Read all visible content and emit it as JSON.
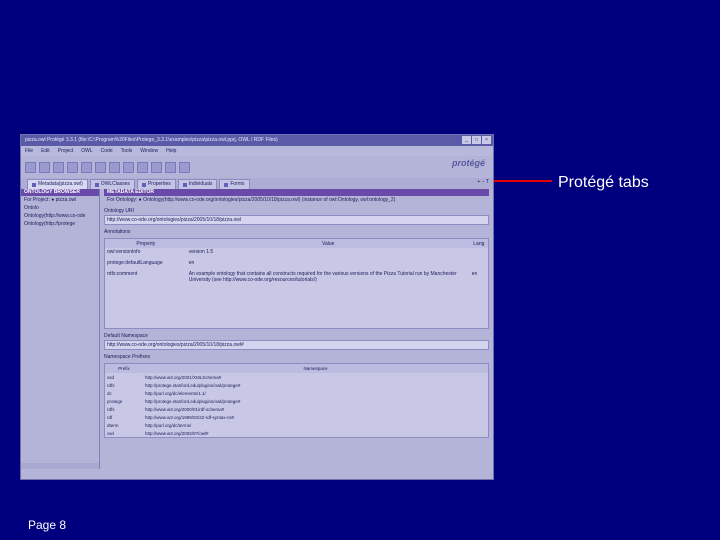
{
  "callout": "Protégé tabs",
  "page_label": "Page 8",
  "window": {
    "title": "pizza.owl  Protégé 3.3.1   (file:\\C:\\Program%20Files\\Protege_3.3.1\\examples\\pizza\\pizza.owl.pprj, OWL / RDF Files)",
    "controls": [
      "_",
      "□",
      "×"
    ]
  },
  "menu": [
    "File",
    "Edit",
    "Project",
    "OWL",
    "Code",
    "Tools",
    "Window",
    "Help"
  ],
  "logo": "protégé",
  "tabs": [
    {
      "label": "Metadata(pizza.owl)",
      "active": true
    },
    {
      "label": "OWLClasses",
      "active": false
    },
    {
      "label": "Properties",
      "active": false
    },
    {
      "label": "Individuals",
      "active": false
    },
    {
      "label": "Forms",
      "active": false
    }
  ],
  "tab_controls": "+  −  T",
  "left": {
    "header": "ONTOLOGY BROWSER",
    "project": "For Project:  ● pizza.owl",
    "ontologies": "Ontolo",
    "item1": "Ontology(http://www.co-ode",
    "item2": "Ontology(http://protege"
  },
  "right": {
    "header": "METADATA EDITOR",
    "for_ontology": "For Ontology:  ● Ontology(http://www.co-ode.org/ontologies/pizza/2005/10/18/pizza.owl)    (instance of owl:Ontology, owl:ontology_2)",
    "uri_label": "Ontology URI",
    "uri_value": "http://www.co-ode.org/ontologies/pizza/2005/10/18/pizza.owl",
    "annotations_label": "Annotations",
    "annot_headers": [
      "Property",
      "Value",
      "Lang"
    ],
    "annotations": [
      {
        "prop": "owl:versionInfo",
        "value": "version 1.5",
        "lang": ""
      },
      {
        "prop": "protege:defaultLanguage",
        "value": "en",
        "lang": ""
      },
      {
        "prop": "rdfs:comment",
        "value": "An example ontology that contains all constructs required for the various versions of the Pizza Tutorial run by Manchester University (see http://www.co-ode.org/resources/tutorials/)",
        "lang": "en"
      }
    ],
    "default_ns_label": "Default Namespace",
    "default_ns_value": "http://www.co-ode.org/ontologies/pizza/2005/10/18/pizza.owl#",
    "ns_prefixes_label": "Namespace Prefixes",
    "ns_headers": [
      "Prefix",
      "Namespace"
    ],
    "namespaces": [
      {
        "prefix": "xsd",
        "ns": "http://www.w3.org/2001/XMLSchema#"
      },
      {
        "prefix": "rdfs",
        "ns": "http://protege.stanford.edu/plugins/owl/protege#"
      },
      {
        "prefix": "dc",
        "ns": "http://purl.org/dc/elements/1.1/"
      },
      {
        "prefix": "protege",
        "ns": "http://protege.stanford.edu/plugins/owl/protege#"
      },
      {
        "prefix": "rdfs",
        "ns": "http://www.w3.org/2000/01/rdf-schema#"
      },
      {
        "prefix": "rdf",
        "ns": "http://www.w3.org/1999/02/22-rdf-syntax-ns#"
      },
      {
        "prefix": "dterm",
        "ns": "http://purl.org/dc/terms/"
      },
      {
        "prefix": "owl",
        "ns": "http://www.w3.org/2002/07/owl#"
      }
    ]
  }
}
